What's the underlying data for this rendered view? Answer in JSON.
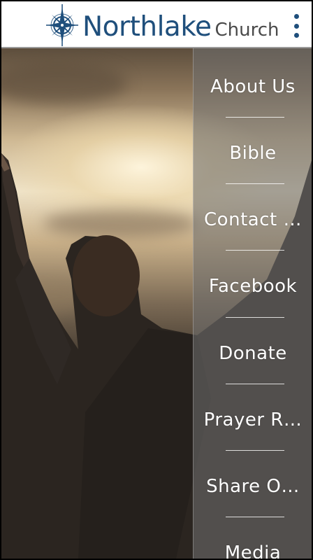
{
  "header": {
    "brand_main": "Northlake",
    "brand_sub": "Church",
    "logo_icon": "compass-rose-icon",
    "menu_icon": "overflow-menu-icon"
  },
  "colors": {
    "brand_blue": "#1f4f7c",
    "menu_overlay": "#6e6e6e",
    "menu_text": "#ffffff"
  },
  "menu": {
    "items": [
      {
        "label": "About Us"
      },
      {
        "label": "Bible"
      },
      {
        "label": "Contact …"
      },
      {
        "label": "Facebook"
      },
      {
        "label": "Donate"
      },
      {
        "label": "Prayer R…"
      },
      {
        "label": "Share O…"
      },
      {
        "label": "Media"
      }
    ]
  }
}
